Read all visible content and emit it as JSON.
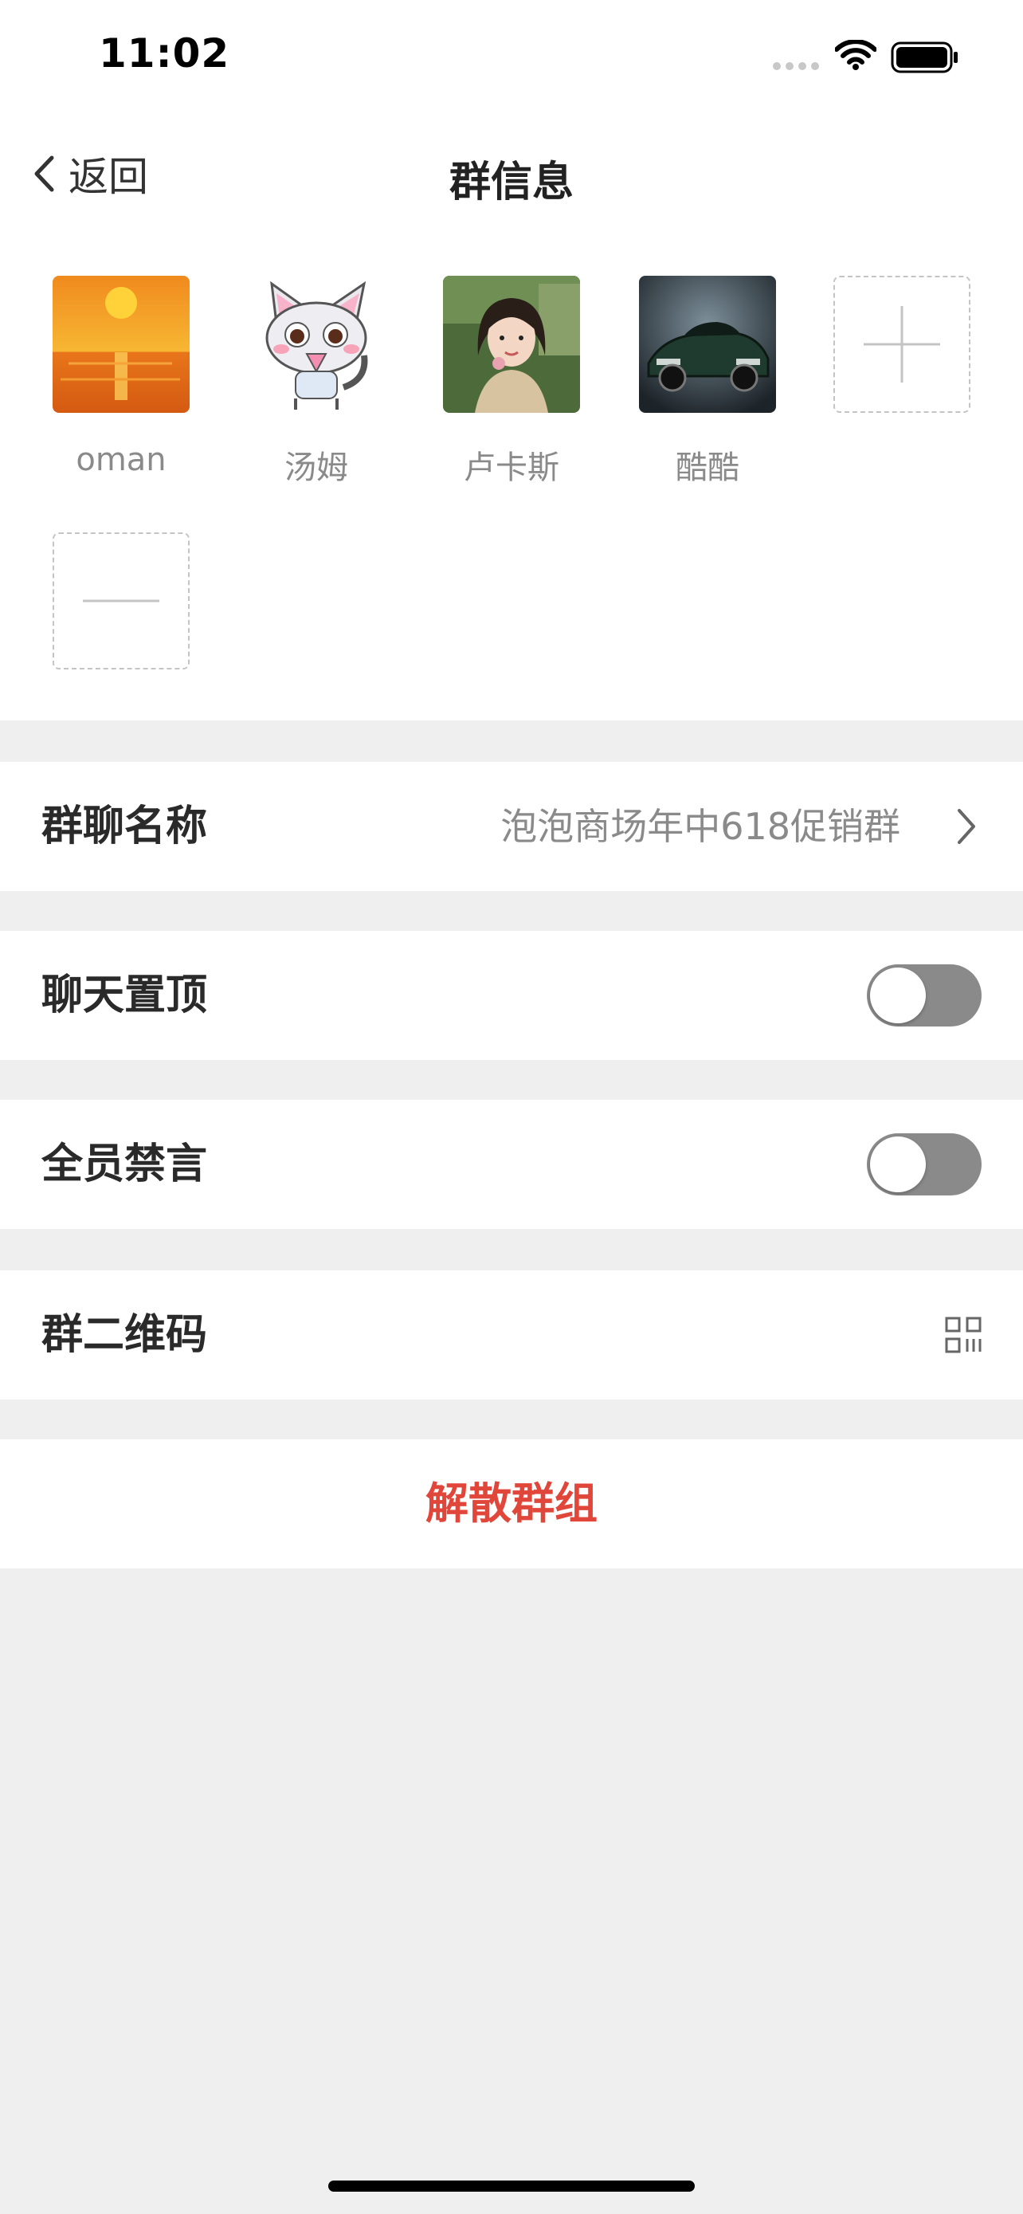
{
  "status_bar": {
    "time": "11:02"
  },
  "nav": {
    "back_label": "返回",
    "title": "群信息"
  },
  "members": [
    {
      "name": "oman",
      "avatar": "sunset-avatar"
    },
    {
      "name": "汤姆",
      "avatar": "cartoon-cat-avatar"
    },
    {
      "name": "卢卡斯",
      "avatar": "girl-photo-avatar"
    },
    {
      "name": "酷酷",
      "avatar": "sports-car-avatar"
    }
  ],
  "member_actions": {
    "add": "plus-icon",
    "remove": "minus-icon"
  },
  "settings": {
    "group_name": {
      "label": "群聊名称",
      "value": "泡泡商场年中618促销群"
    },
    "pin_chat": {
      "label": "聊天置顶",
      "enabled": false
    },
    "mute_all": {
      "label": "全员禁言",
      "enabled": false
    },
    "qr_code": {
      "label": "群二维码",
      "icon": "qr-code-icon"
    }
  },
  "dissolve": {
    "label": "解散群组"
  },
  "colors": {
    "background": "#efefef",
    "danger": "#e0463a",
    "toggle_off": "#8a8a8a",
    "secondary_text": "#8a8a8a"
  }
}
